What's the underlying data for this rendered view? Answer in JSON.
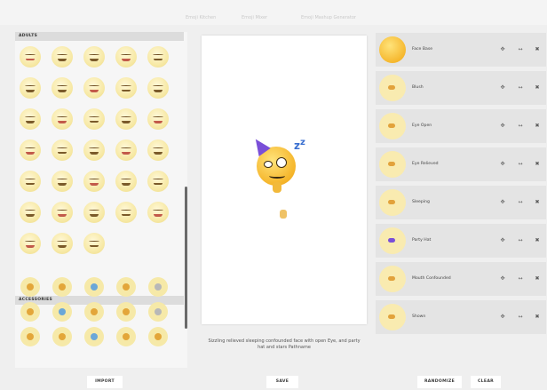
{
  "top_tabs": [
    "Emoji Kitchen",
    "Emoji Mixer",
    "Emoji Mashup Generator"
  ],
  "palette": {
    "sections": [
      "ADULTS",
      "ACCESSORIES"
    ],
    "face_count": 33,
    "accessory_count": 17
  },
  "canvas": {
    "description": "Sizzling relieved sleeping confounded face with open Eye, and party hat and stars Pathname"
  },
  "layers": [
    {
      "label": "Face Base",
      "thumb": "face-base-icon"
    },
    {
      "label": "Blush",
      "thumb": "blush-icon"
    },
    {
      "label": "Eye Open",
      "thumb": "eye-open-icon"
    },
    {
      "label": "Eye Relieved",
      "thumb": "eye-relieved-icon"
    },
    {
      "label": "Sleeping",
      "thumb": "sleeping-icon"
    },
    {
      "label": "Party Hat",
      "thumb": "party-hat-icon"
    },
    {
      "label": "Mouth Confounded",
      "thumb": "mouth-confounded-icon"
    },
    {
      "label": "Shown",
      "thumb": "hand-shown-icon"
    }
  ],
  "layer_controls": {
    "move": "✥",
    "resize": "↔",
    "delete": "✖"
  },
  "buttons": {
    "import": "IMPORT",
    "save": "SAVE",
    "randomize": "RANDOMIZE",
    "clear": "CLEAR"
  },
  "colors": {
    "face_yellow": "#f5b52a",
    "pale_yellow": "#f7e9a6",
    "panel_gray": "#e4e4e4",
    "hat_purple": "#7a4fd8",
    "zzz_blue": "#3a6fd0"
  }
}
